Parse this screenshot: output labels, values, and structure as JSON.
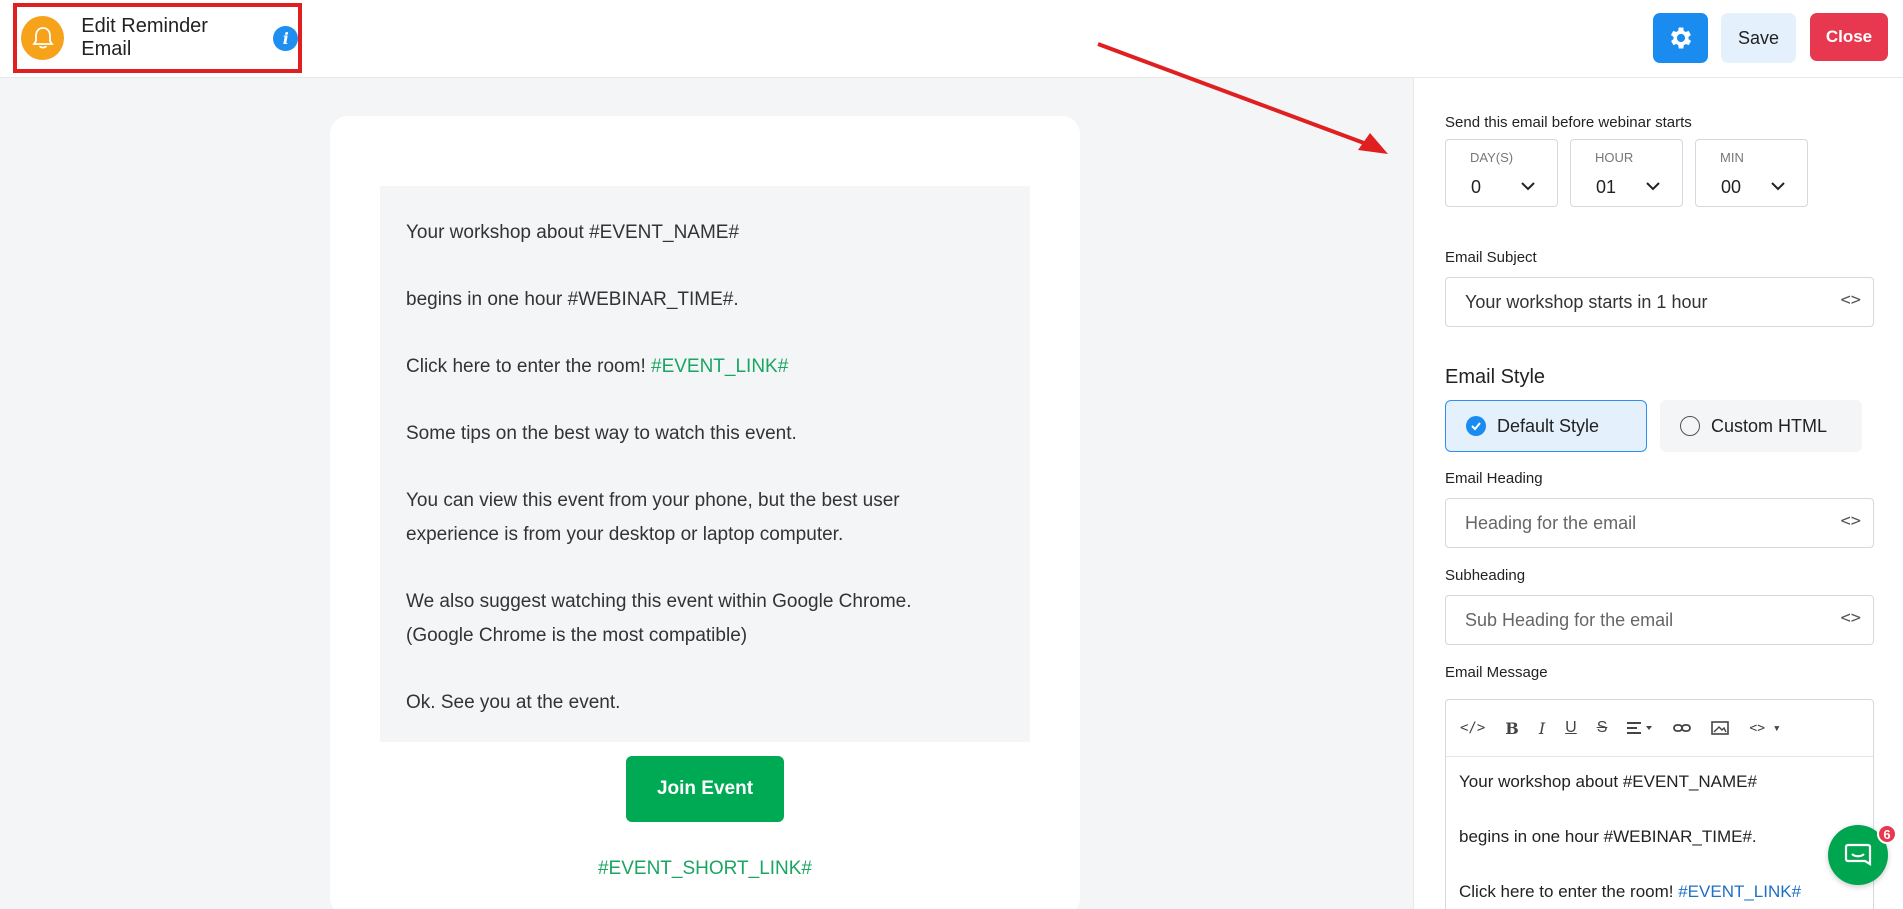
{
  "header": {
    "title": "Edit Reminder Email",
    "info_icon": "i",
    "save_label": "Save",
    "close_label": "Close"
  },
  "preview": {
    "line1": "Your workshop about #EVENT_NAME#",
    "line2": "begins in one hour #WEBINAR_TIME#.",
    "line3_text": "Click here to enter the room! ",
    "line3_token": "#EVENT_LINK#",
    "line4": "Some tips on the best way to watch this event.",
    "line5": "You can view this event from your phone, but the best user experience is from your desktop or laptop computer.",
    "line6": "We also suggest watching this event within Google Chrome. (Google Chrome is the most compatible)",
    "line7": "Ok. See you at the event.",
    "join_button": "Join Event",
    "short_link": "#EVENT_SHORT_LINK#"
  },
  "panel": {
    "send_label": "Send this email before webinar starts",
    "days": {
      "label": "DAY(S)",
      "value": "0"
    },
    "hour": {
      "label": "HOUR",
      "value": "01"
    },
    "min": {
      "label": "MIN",
      "value": "00"
    },
    "subject_label": "Email Subject",
    "subject_value": "Your workshop starts in 1 hour",
    "style_title": "Email Style",
    "style_default": "Default Style",
    "style_custom": "Custom HTML",
    "heading_label": "Email Heading",
    "heading_placeholder": "Heading for the email",
    "subheading_label": "Subheading",
    "subheading_placeholder": "Sub Heading for the email",
    "message_label": "Email Message",
    "editor": {
      "line1": "Your workshop about #EVENT_NAME#",
      "line2": "begins in one hour #WEBINAR_TIME#.",
      "line3_text": "Click here to enter the room! ",
      "line3_link": "#EVENT_LINK#"
    }
  },
  "chat": {
    "badge": "6"
  },
  "colors": {
    "primary": "#1a8cf0",
    "danger": "#e8384f",
    "success": "#00aa55",
    "accent_orange": "#f7a21b"
  }
}
